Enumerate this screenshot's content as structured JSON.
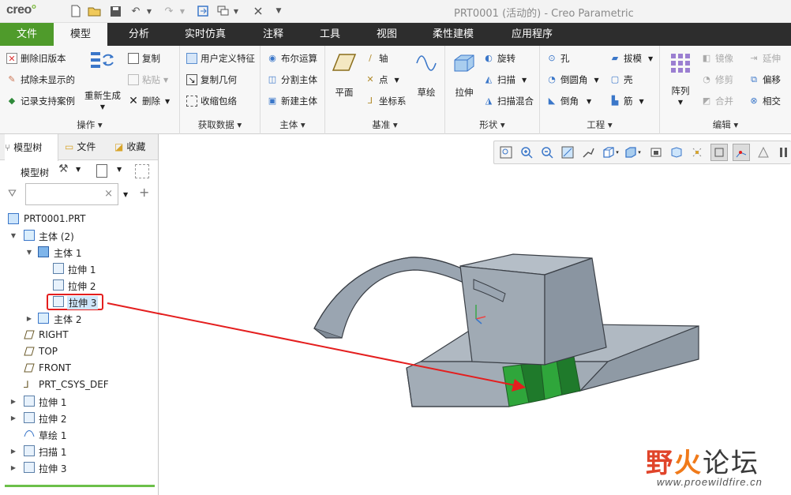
{
  "app": {
    "logo": "creo",
    "logo_dot": "°",
    "window_title": "PRT0001 (活动的) - Creo Parametric"
  },
  "tabs": [
    "文件",
    "模型",
    "分析",
    "实时仿真",
    "注释",
    "工具",
    "视图",
    "柔性建模",
    "应用程序"
  ],
  "ribbon": {
    "operations": {
      "items": [
        "删除旧版本",
        "拭除未显示的",
        "记录支持案例"
      ],
      "regenerate": "重新生成",
      "copy": "复制",
      "paste": "粘贴",
      "delete": "删除",
      "label": "操作"
    },
    "get_data": {
      "items": [
        "用户定义特征",
        "复制几何",
        "收缩包络"
      ],
      "label": "获取数据"
    },
    "body": {
      "items": [
        "布尔运算",
        "分割主体",
        "新建主体"
      ],
      "label": "主体"
    },
    "datum": {
      "plane": "平面",
      "axis": "轴",
      "point": "点",
      "csys": "坐标系",
      "sketch": "草绘",
      "label": "基准"
    },
    "shapes": {
      "extrude": "拉伸",
      "revolve": "旋转",
      "sweep": "扫描",
      "swept_blend": "扫描混合",
      "label": "形状"
    },
    "engineering": {
      "hole": "孔",
      "round": "倒圆角",
      "chamfer": "倒角",
      "draft": "拔模",
      "shell": "壳",
      "rib": "筋",
      "label": "工程"
    },
    "editing": {
      "pattern": "阵列",
      "mirror": "镜像",
      "trim": "修剪",
      "merge": "合并",
      "extend": "延伸",
      "offset": "偏移",
      "intersect": "相交",
      "label": "编辑"
    }
  },
  "panel": {
    "tabs": [
      "模型树",
      "文件",
      "收藏"
    ],
    "tree_label": "模型树",
    "search_placeholder": "",
    "clear": "×",
    "add": "+",
    "tree": [
      "PRT0001.PRT",
      "主体 (2)",
      "主体 1",
      "拉伸 1",
      "拉伸 2",
      "拉伸 3",
      "主体 2",
      "RIGHT",
      "TOP",
      "FRONT",
      "PRT_CSYS_DEF",
      "拉伸 1",
      "拉伸 2",
      "草绘 1",
      "扫描 1",
      "拉伸 3"
    ]
  },
  "watermark": {
    "title_a": "野",
    "title_b": "火",
    "title_c": "论坛",
    "url": "www.proewildfire.cn"
  },
  "colors": {
    "accent_green": "#4f9b2b",
    "selection_red": "#e41e1e",
    "model_fill": "#a2acb6",
    "highlight_green": "#33a63a"
  }
}
